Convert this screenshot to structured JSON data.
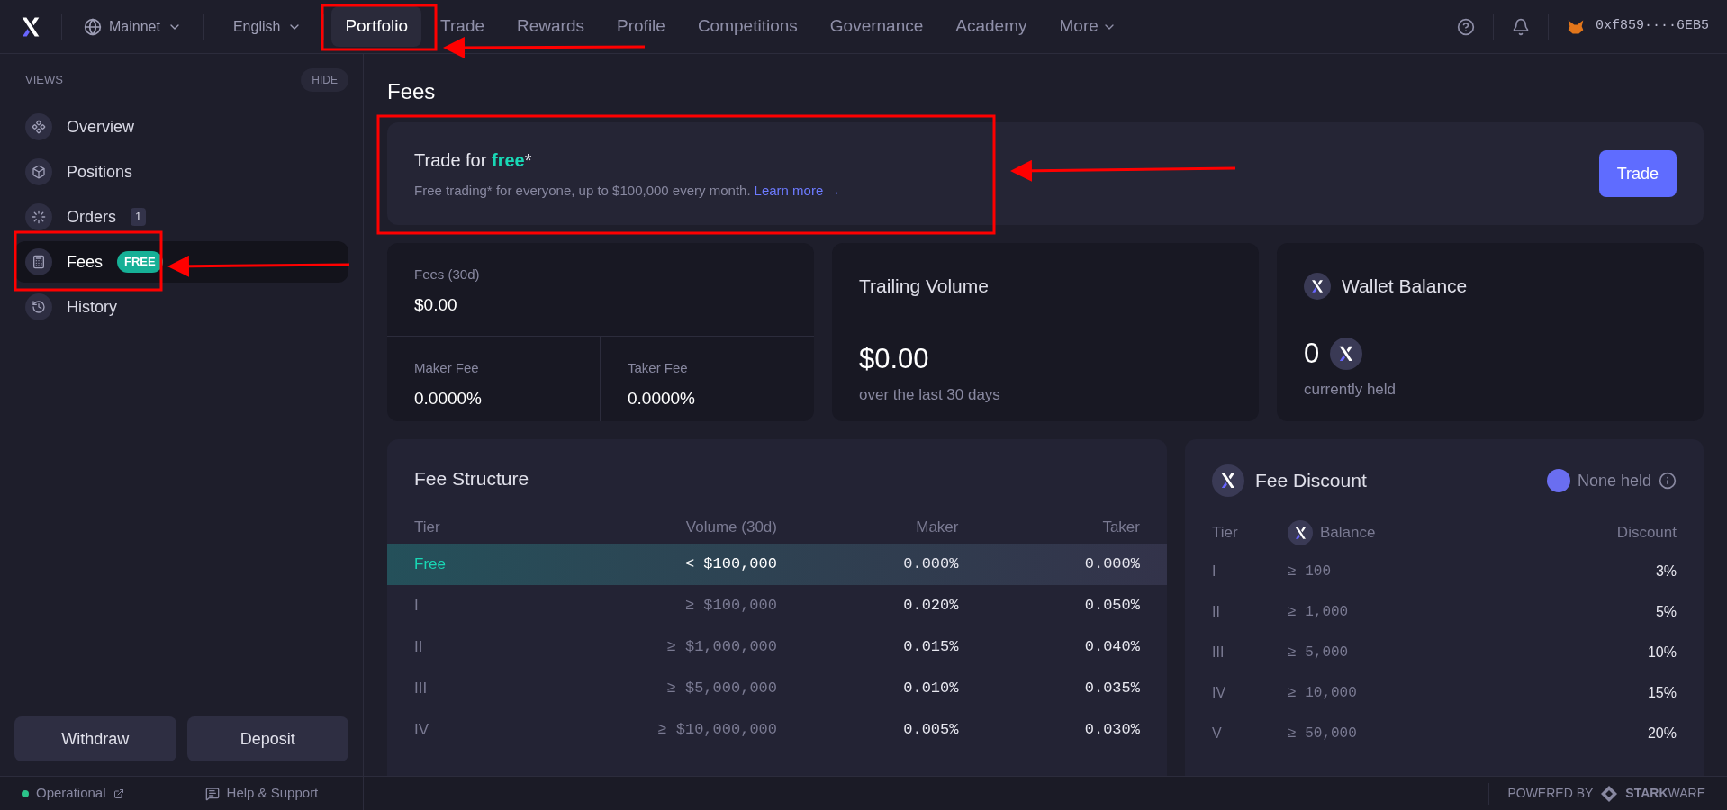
{
  "topbar": {
    "network": "Mainnet",
    "language": "English",
    "nav": [
      {
        "label": "Portfolio",
        "selected": true
      },
      {
        "label": "Trade",
        "selected": false
      },
      {
        "label": "Rewards",
        "selected": false
      },
      {
        "label": "Profile",
        "selected": false
      },
      {
        "label": "Competitions",
        "selected": false
      },
      {
        "label": "Governance",
        "selected": false
      },
      {
        "label": "Academy",
        "selected": false
      },
      {
        "label": "More",
        "selected": false,
        "dropdown": true
      }
    ],
    "wallet": "0xf859····6EB5"
  },
  "sidebar": {
    "heading": "VIEWS",
    "hide": "HIDE",
    "items": [
      {
        "label": "Overview",
        "selected": false
      },
      {
        "label": "Positions",
        "selected": false
      },
      {
        "label": "Orders",
        "selected": false,
        "badge": {
          "text": "1",
          "kind": "count"
        }
      },
      {
        "label": "Fees",
        "selected": true,
        "badge": {
          "text": "FREE",
          "kind": "tag"
        }
      },
      {
        "label": "History",
        "selected": false
      }
    ],
    "buttons": [
      "Withdraw",
      "Deposit"
    ]
  },
  "main": {
    "title": "Fees",
    "banner": {
      "title": "Trade for",
      "highlight": "free",
      "suffix": "*",
      "text": "Free trading* for everyone, up to $100,000 every month.",
      "link": "Learn more →",
      "button": "Trade"
    },
    "fees_card": {
      "label": "Fees (30d)",
      "value": "$0.00",
      "maker_label": "Maker Fee",
      "maker_value": "0.0000%",
      "taker_label": "Taker Fee",
      "taker_value": "0.0000%"
    },
    "volume_card": {
      "title": "Trailing Volume",
      "value": "$0.00",
      "caption": "over the last 30 days"
    },
    "wallet_card": {
      "title": "Wallet Balance",
      "value": "0",
      "caption": "currently held"
    },
    "fee_structure": {
      "title": "Fee Structure",
      "columns": [
        "Tier",
        "Volume (30d)",
        "Maker",
        "Taker"
      ],
      "rows": [
        {
          "tier": "Free",
          "volume": "< $100,000",
          "maker": "0.000%",
          "taker": "0.000%",
          "selected": true
        },
        {
          "tier": "I",
          "volume": "≥ $100,000",
          "maker": "0.020%",
          "taker": "0.050%",
          "selected": false
        },
        {
          "tier": "II",
          "volume": "≥ $1,000,000",
          "maker": "0.015%",
          "taker": "0.040%",
          "selected": false
        },
        {
          "tier": "III",
          "volume": "≥ $5,000,000",
          "maker": "0.010%",
          "taker": "0.035%",
          "selected": false
        },
        {
          "tier": "IV",
          "volume": "≥ $10,000,000",
          "maker": "0.005%",
          "taker": "0.030%",
          "selected": false
        }
      ]
    },
    "fee_discount": {
      "title": "Fee Discount",
      "status": "None held",
      "columns": [
        "Tier",
        "Balance",
        "Discount"
      ],
      "rows": [
        {
          "tier": "I",
          "balance": "≥ 100",
          "discount": "3%"
        },
        {
          "tier": "II",
          "balance": "≥ 1,000",
          "discount": "5%"
        },
        {
          "tier": "III",
          "balance": "≥ 5,000",
          "discount": "10%"
        },
        {
          "tier": "IV",
          "balance": "≥ 10,000",
          "discount": "15%"
        },
        {
          "tier": "V",
          "balance": "≥ 50,000",
          "discount": "20%"
        }
      ]
    }
  },
  "footer": {
    "status": "Operational",
    "help": "Help & Support",
    "powered": "POWERED BY",
    "brand": "**STARK**WARE"
  }
}
